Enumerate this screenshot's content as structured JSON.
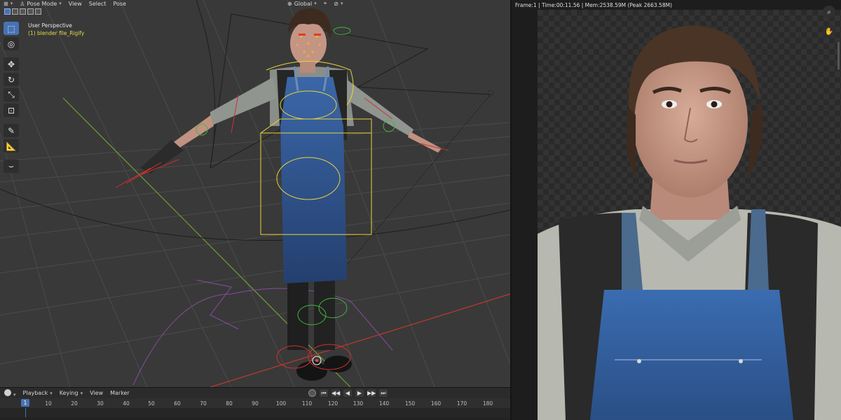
{
  "viewport": {
    "header": {
      "editor_icon": "3d-viewport-icon",
      "mode_label": "Pose Mode",
      "menus": [
        "View",
        "Select",
        "Pose"
      ],
      "orientation": "Global"
    },
    "overlay": {
      "perspective": "User Perspective",
      "object_name": "(1) blender file_Rigify"
    },
    "tools": [
      {
        "name": "select-box-tool",
        "glyph": "⬚",
        "active": true
      },
      {
        "name": "cursor-tool",
        "glyph": "◎",
        "active": false
      },
      {
        "name": "move-tool",
        "glyph": "✥",
        "active": false
      },
      {
        "name": "rotate-tool",
        "glyph": "↻",
        "active": false
      },
      {
        "name": "scale-tool",
        "glyph": "⤡",
        "active": false
      },
      {
        "name": "transform-tool",
        "glyph": "⊡",
        "active": false
      },
      {
        "name": "annotate-tool",
        "glyph": "✎",
        "active": false
      },
      {
        "name": "measure-tool",
        "glyph": "📐",
        "active": false
      },
      {
        "name": "bone-tool",
        "glyph": "⌣",
        "active": false
      }
    ],
    "colors": {
      "background": "#393939",
      "grid": "#4a4a4a",
      "x_axis": "#c0392b",
      "y_axis": "#6aa032",
      "rig_yellow": "#e8d43a",
      "rig_green": "#3fb83f",
      "rig_red": "#d03030",
      "apron": "#2c4f8a"
    }
  },
  "timeline": {
    "menus": [
      "Playback",
      "Keying",
      "View",
      "Marker"
    ],
    "current_frame": "1",
    "frame_ticks": [
      "10",
      "20",
      "30",
      "40",
      "50",
      "60",
      "70",
      "80",
      "90",
      "100",
      "110",
      "120",
      "130",
      "140",
      "150",
      "160",
      "170",
      "180"
    ],
    "transport": [
      "⏮",
      "◀◀",
      "◀",
      "▶",
      "▶▶",
      "⏭"
    ]
  },
  "render": {
    "stats": "Frame:1 | Time:00:11.56 | Mem:2538.59M (Peak 2663.58M)",
    "side_icons": [
      "zoom-icon",
      "hand-pan-icon"
    ],
    "colors": {
      "skin": "#c99a86",
      "hair": "#4a3425",
      "shirt": "#b8b8b0",
      "vest": "#2a2a2a",
      "apron": "#2f5a99",
      "checker_dark": "#2a2a2a",
      "checker_light": "#333333"
    }
  }
}
